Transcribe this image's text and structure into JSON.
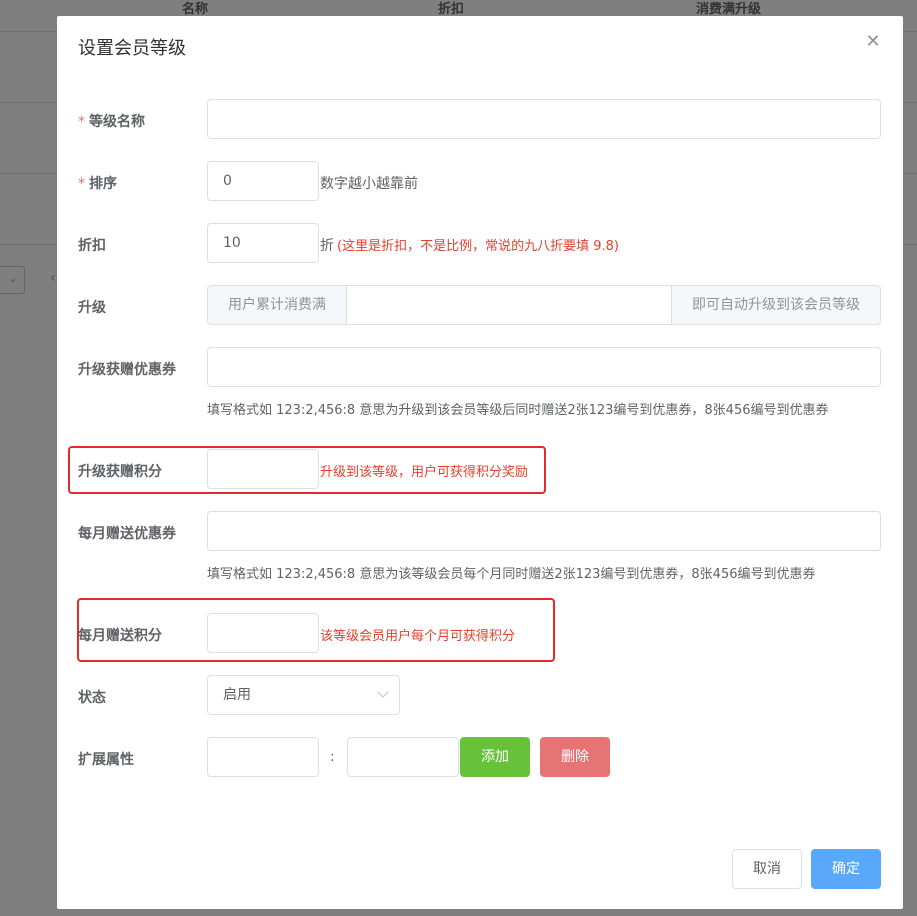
{
  "background": {
    "columns": [
      "名称",
      "折扣",
      "消费满升级"
    ]
  },
  "dialog": {
    "title": "设置会员等级",
    "close_icon": "close-icon",
    "fields": {
      "level_name": {
        "label": "等级名称",
        "required": "*",
        "value": ""
      },
      "sort": {
        "label": "排序",
        "required": "*",
        "value": "0",
        "hint": "数字越小越靠前"
      },
      "discount": {
        "label": "折扣",
        "value": "10",
        "unit": "折",
        "hint": "(这里是折扣，不是比例，常说的九八折要填 9.8)"
      },
      "upgrade": {
        "label": "升级",
        "prefix": "用户累计消费满",
        "value": "",
        "suffix": "即可自动升级到该会员等级"
      },
      "upgrade_coupon": {
        "label": "升级获赠优惠券",
        "value": "",
        "hint": "填写格式如 123:2,456:8 意思为升级到该会员等级后同时赠送2张123编号到优惠券，8张456编号到优惠券"
      },
      "upgrade_points": {
        "label": "升级获赠积分",
        "value": "",
        "hint": "升级到该等级，用户可获得积分奖励"
      },
      "monthly_coupon": {
        "label": "每月赠送优惠券",
        "value": "",
        "hint": "填写格式如 123:2,456:8 意思为该等级会员每个月同时赠送2张123编号到优惠券，8张456编号到优惠券"
      },
      "monthly_points": {
        "label": "每月赠送积分",
        "value": "",
        "hint": "该等级会员用户每个月可获得积分"
      },
      "status": {
        "label": "状态",
        "value": "启用"
      },
      "ext": {
        "label": "扩展属性",
        "key": "",
        "separator": ":",
        "val": "",
        "add_label": "添加",
        "delete_label": "删除"
      }
    },
    "footer": {
      "cancel_label": "取消",
      "ok_label": "确定"
    }
  },
  "colors": {
    "highlight": "#e32b2b",
    "add_button": "#67c23a",
    "delete_button": "#e77474",
    "ok_button": "#5aa8fb",
    "required": "#f56c6c"
  }
}
